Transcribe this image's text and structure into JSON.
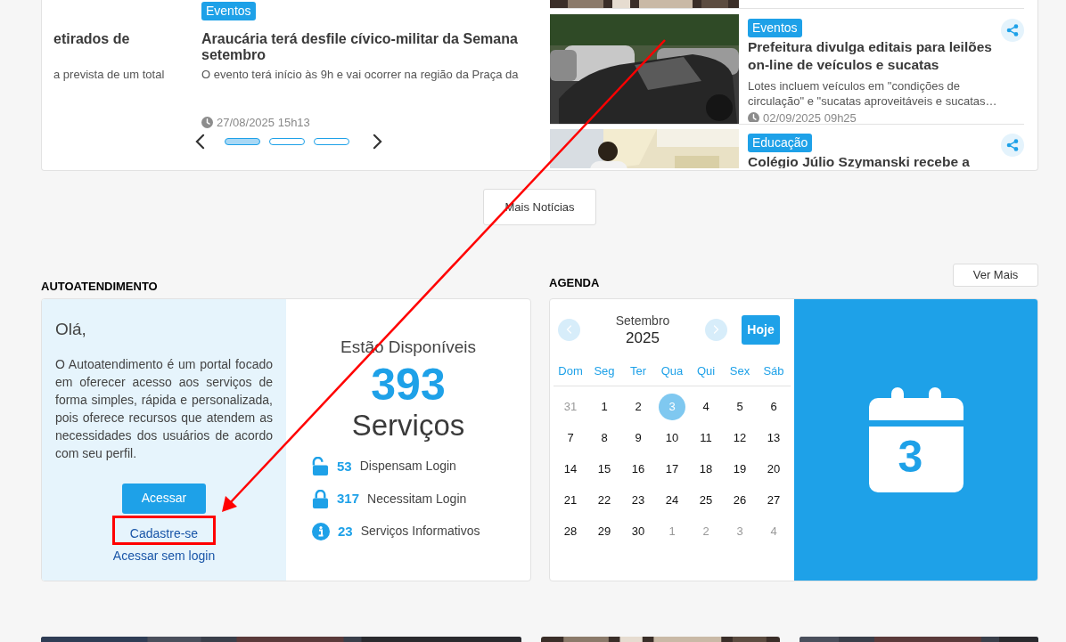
{
  "carousel": {
    "slides": [
      {
        "title_lines": [
          "etirados de"
        ],
        "summary": "a prevista de um total"
      },
      {
        "tag": "Eventos",
        "title_lines": [
          "Araucária terá desfile cívico-militar da Semana",
          "setembro"
        ],
        "summary": "O evento terá início às 9h e vai ocorrer na região da Praça da",
        "date": "27/08/2025 15h13"
      }
    ],
    "dots": [
      {
        "selected": true
      },
      {
        "selected": false
      },
      {
        "selected": false
      }
    ]
  },
  "news_list": [
    {
      "tag": "Eventos",
      "title": "Prefeitura divulga editais para leilões on-line de veículos e sucatas",
      "summary": "Lotes incluem veículos em \"condições de circulação\" e \"sucatas aproveitáveis e sucatas…",
      "date": "02/09/2025 09h25"
    },
    {
      "tag": "Educação",
      "title": "Colégio Júlio Szymanski recebe a"
    }
  ],
  "more_news_button": "Mais Notícias",
  "self_service": {
    "heading": "AUTOATENDIMENTO",
    "greeting": "Olá,",
    "description": "O Autoatendimento é um portal focado em oferecer acesso aos serviços de forma simples, rápida e personalizada, pois oferece recursos que atendem as necessidades dos usuários de acordo com seu perfil.",
    "access_button": "Acessar",
    "signup_link": "Cadastre-se",
    "guest_link": "Acessar sem login",
    "available_label": "Estão Disponíveis",
    "total": "393",
    "unit": "Serviços",
    "stats": [
      {
        "kind": "unlocked",
        "count": "53",
        "label": "Dispensam Login"
      },
      {
        "kind": "locked",
        "count": "317",
        "label": "Necessitam Login"
      },
      {
        "kind": "info",
        "count": "23",
        "label": "Serviços Informativos"
      }
    ]
  },
  "agenda": {
    "heading": "AGENDA",
    "more_button": "Ver Mais",
    "month": "Setembro",
    "year": "2025",
    "today_button": "Hoje",
    "weekdays": [
      "Dom",
      "Seg",
      "Ter",
      "Qua",
      "Qui",
      "Sex",
      "Sáb"
    ],
    "days": [
      {
        "label": "31",
        "outside": true,
        "selected": false
      },
      {
        "label": "1",
        "outside": false,
        "selected": false
      },
      {
        "label": "2",
        "outside": false,
        "selected": false
      },
      {
        "label": "3",
        "outside": false,
        "selected": true
      },
      {
        "label": "4",
        "outside": false,
        "selected": false
      },
      {
        "label": "5",
        "outside": false,
        "selected": false
      },
      {
        "label": "6",
        "outside": false,
        "selected": false
      },
      {
        "label": "7",
        "outside": false,
        "selected": false
      },
      {
        "label": "8",
        "outside": false,
        "selected": false
      },
      {
        "label": "9",
        "outside": false,
        "selected": false
      },
      {
        "label": "10",
        "outside": false,
        "selected": false
      },
      {
        "label": "11",
        "outside": false,
        "selected": false
      },
      {
        "label": "12",
        "outside": false,
        "selected": false
      },
      {
        "label": "13",
        "outside": false,
        "selected": false
      },
      {
        "label": "14",
        "outside": false,
        "selected": false
      },
      {
        "label": "15",
        "outside": false,
        "selected": false
      },
      {
        "label": "16",
        "outside": false,
        "selected": false
      },
      {
        "label": "17",
        "outside": false,
        "selected": false
      },
      {
        "label": "18",
        "outside": false,
        "selected": false
      },
      {
        "label": "19",
        "outside": false,
        "selected": false
      },
      {
        "label": "20",
        "outside": false,
        "selected": false
      },
      {
        "label": "21",
        "outside": false,
        "selected": false
      },
      {
        "label": "22",
        "outside": false,
        "selected": false
      },
      {
        "label": "23",
        "outside": false,
        "selected": false
      },
      {
        "label": "24",
        "outside": false,
        "selected": false
      },
      {
        "label": "25",
        "outside": false,
        "selected": false
      },
      {
        "label": "26",
        "outside": false,
        "selected": false
      },
      {
        "label": "27",
        "outside": false,
        "selected": false
      },
      {
        "label": "28",
        "outside": false,
        "selected": false
      },
      {
        "label": "29",
        "outside": false,
        "selected": false
      },
      {
        "label": "30",
        "outside": false,
        "selected": false
      },
      {
        "label": "1",
        "outside": true,
        "selected": false
      },
      {
        "label": "2",
        "outside": true,
        "selected": false
      },
      {
        "label": "3",
        "outside": true,
        "selected": false
      },
      {
        "label": "4",
        "outside": true,
        "selected": false
      }
    ],
    "icon_day": "3"
  }
}
